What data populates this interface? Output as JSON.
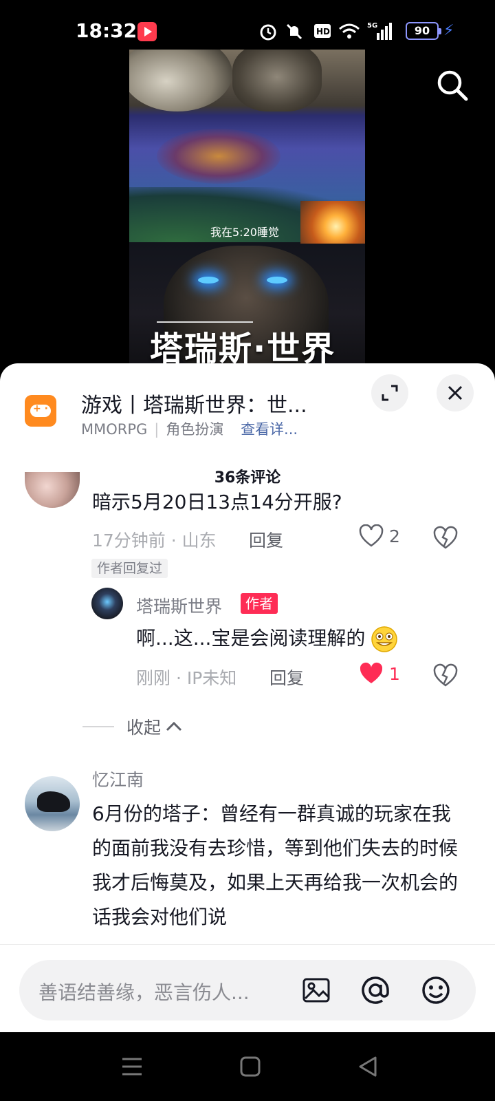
{
  "status_bar": {
    "time": "18:32",
    "battery": "90",
    "icons": [
      "alarm-icon",
      "mute-icon",
      "hd-icon",
      "wifi-icon",
      "signal-5g-icon",
      "battery-icon",
      "charging-icon"
    ]
  },
  "video": {
    "caption": "我在5:20睡觉",
    "logo_text": "塔瑞斯·世界"
  },
  "sheet": {
    "title": "游戏丨塔瑞斯世界：世...",
    "subtitle_genre1": "MMORPG",
    "subtitle_sep": "|",
    "subtitle_genre2": "角色扮演",
    "subtitle_link": "查看详...",
    "comment_count": "36条评论"
  },
  "comments": {
    "c1": {
      "text": "暗示5月20日13点14分开服?",
      "meta": "17分钟前 · 山东",
      "reply": "回复",
      "likes": "2",
      "badge": "作者回复过"
    },
    "reply1": {
      "name": "塔瑞斯世界",
      "tag": "作者",
      "text": "啊...这...宝是会阅读理解的",
      "meta": "刚刚 · IP未知",
      "reply": "回复",
      "likes": "1",
      "liked_color": "#fe2c55"
    },
    "collapse": "收起",
    "c3": {
      "name": "忆江南",
      "text": "6月份的塔子：曾经有一群真诚的玩家在我的面前我没有去珍惜，等到他们失去的时候我才后悔莫及，如果上天再给我一次机会的话我会对他们说"
    }
  },
  "input": {
    "placeholder": "善语结善缘，恶言伤人..."
  },
  "colors": {
    "accent": "#fe2c55",
    "game_icon": "#ff8a1f",
    "link": "#4d6aa8"
  }
}
